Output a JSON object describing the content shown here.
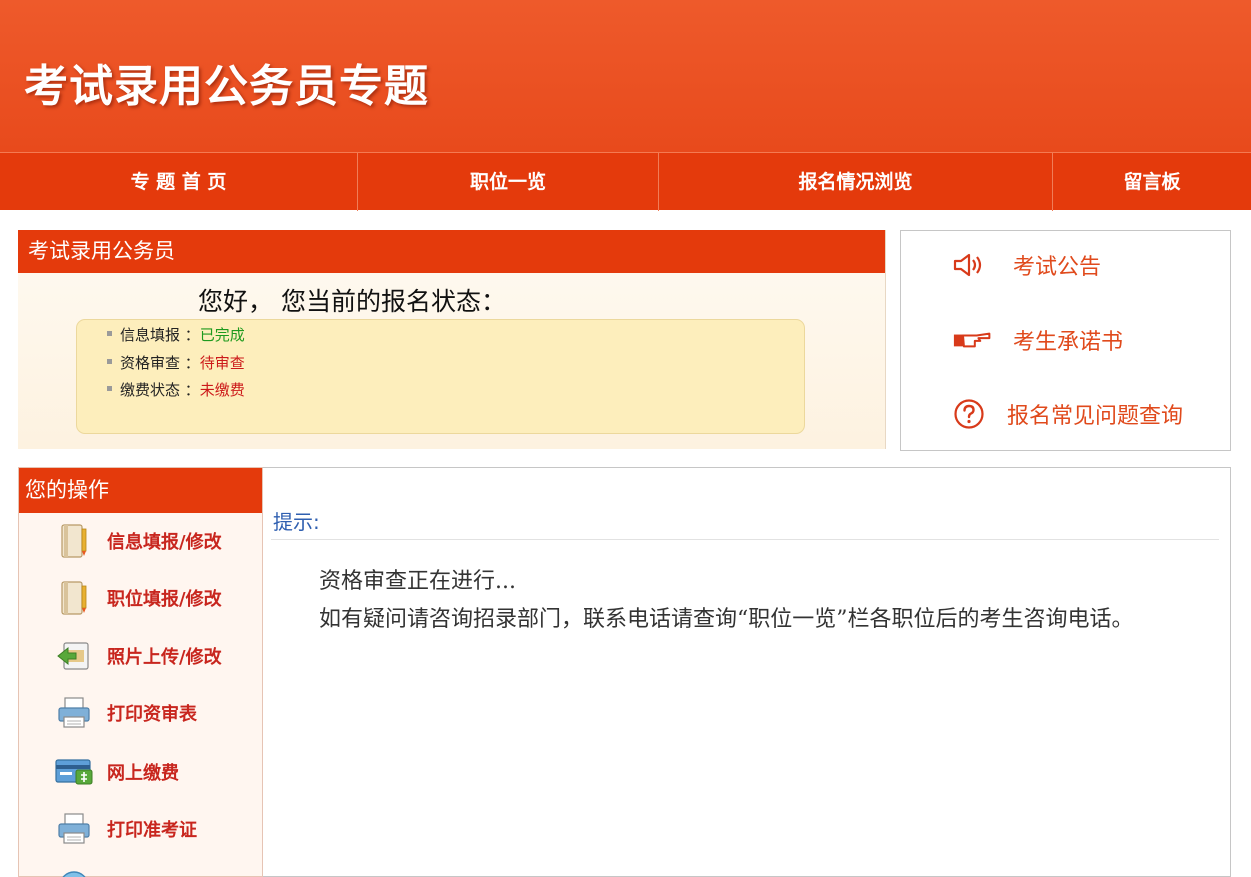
{
  "banner": {
    "title": "考试录用公务员专题"
  },
  "nav": {
    "items": [
      {
        "label": "专 题 首 页"
      },
      {
        "label": "职位一览"
      },
      {
        "label": "报名情况浏览"
      },
      {
        "label": "留言板"
      }
    ]
  },
  "status_panel": {
    "header": "考试录用公务员",
    "greeting": "您好， 您当前的报名状态：",
    "rows": [
      {
        "label": "信息填报 ：",
        "value": "已完成"
      },
      {
        "label": "资格审查 ：",
        "value": "待审查"
      },
      {
        "label": "缴费状态 ：",
        "value": "未缴费"
      }
    ]
  },
  "links": [
    {
      "label": "考试公告",
      "icon": "speaker-icon"
    },
    {
      "label": "考生承诺书",
      "icon": "pointing-hand-icon"
    },
    {
      "label": "报名常见问题查询",
      "icon": "question-icon"
    }
  ],
  "operations": {
    "header": "您的操作",
    "items": [
      {
        "label": "信息填报/修改",
        "icon": "document-icon"
      },
      {
        "label": "职位填报/修改",
        "icon": "document-icon"
      },
      {
        "label": "照片上传/修改",
        "icon": "upload-photo-icon"
      },
      {
        "label": "打印资审表",
        "icon": "printer-icon"
      },
      {
        "label": "网上缴费",
        "icon": "payment-card-icon"
      },
      {
        "label": "打印准考证",
        "icon": "printer-icon"
      }
    ]
  },
  "tip": {
    "title": "提示:",
    "line1": "资格审查正在进行...",
    "line2": "如有疑问请咨询招录部门，联系电话请查询“职位一览”栏各职位后的考生咨询电话。"
  },
  "colors": {
    "brand_red": "#e43a0c",
    "banner_orange": "#ee5a2b",
    "status_ok": "#1e9a1e",
    "status_warn": "#cc1a1a",
    "link_orange": "#e04a1c",
    "tip_blue": "#2f5fb0"
  }
}
